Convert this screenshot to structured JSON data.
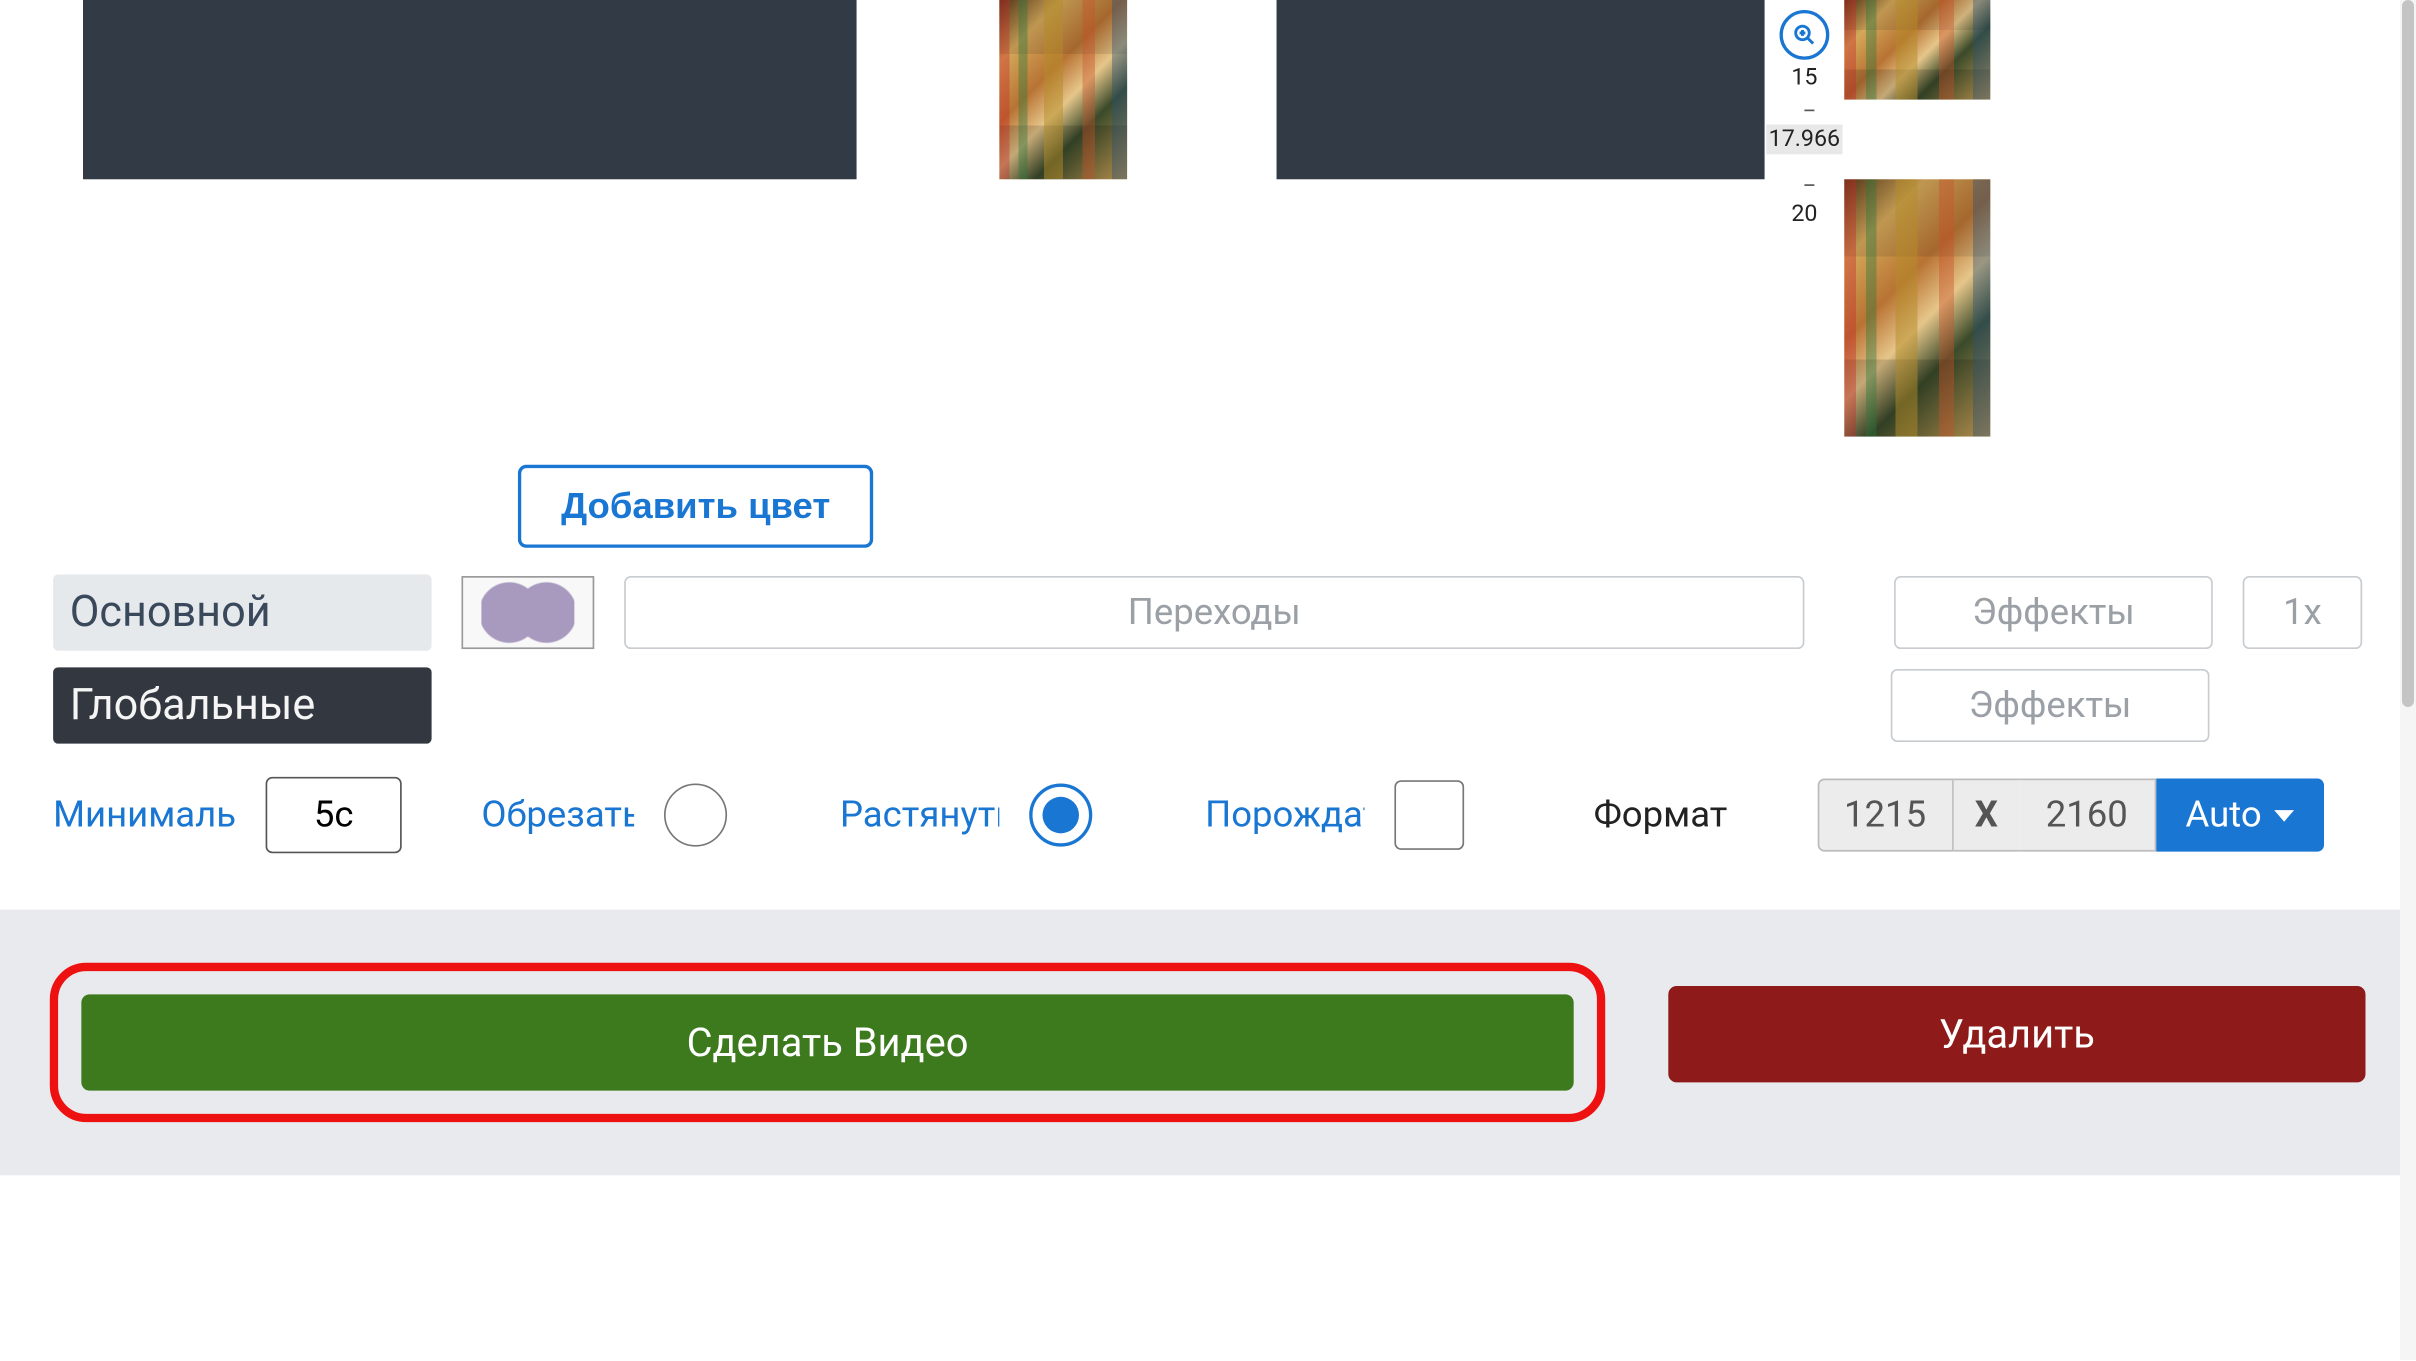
{
  "ruler": {
    "tick_15": "15",
    "current": "17.966",
    "tick_20": "20"
  },
  "buttons": {
    "add_color": "Добавить цвет",
    "make_video": "Сделать Видео",
    "delete": "Удалить",
    "auto": "Auto"
  },
  "tabs": {
    "main": "Основной",
    "global": "Глобальные"
  },
  "placeholders": {
    "transitions": "Переходы",
    "effects": "Эффекты",
    "multiplier": "1x"
  },
  "labels": {
    "minimal": "Минималь",
    "crop": "Обрезать",
    "stretch": "Растянуть",
    "generate": "Порождать",
    "format": "Формат"
  },
  "inputs": {
    "min_duration": "5c",
    "width": "1215",
    "height": "2160",
    "x_sep": "X"
  },
  "state": {
    "crop_selected": false,
    "stretch_selected": true,
    "generate_checked": false
  }
}
